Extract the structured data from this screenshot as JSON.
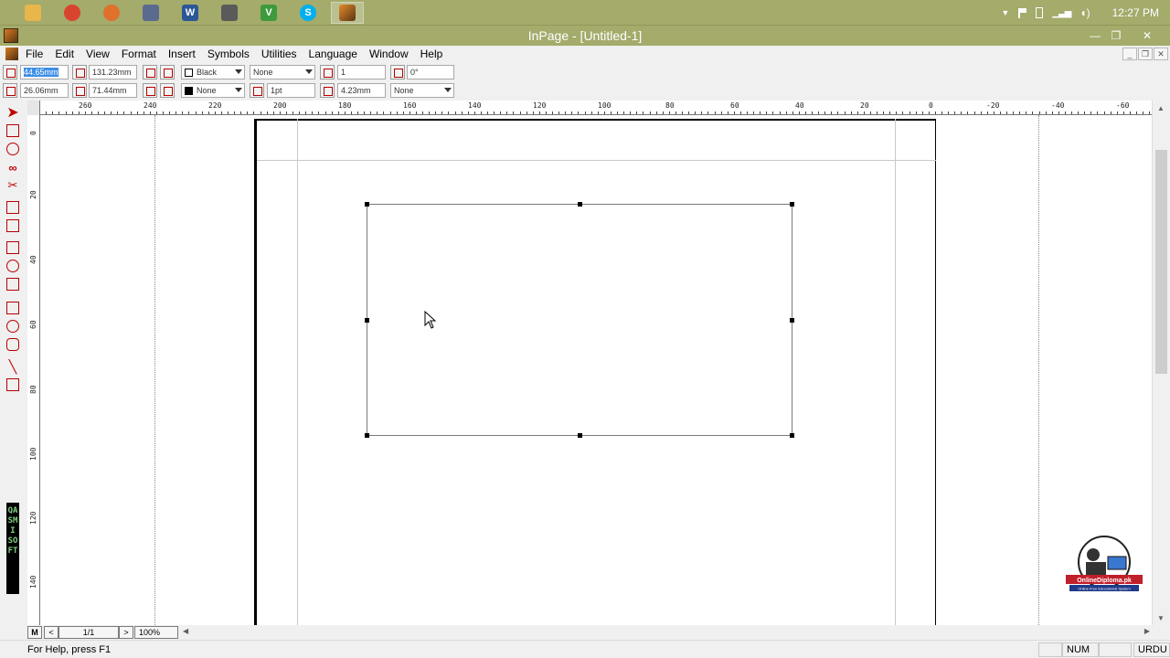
{
  "taskbar": {
    "apps": [
      {
        "icon": "file-explorer-icon",
        "color": "#e8b64a"
      },
      {
        "icon": "chrome-icon",
        "color": "#d9442e"
      },
      {
        "icon": "firefox-icon",
        "color": "#e0712c"
      },
      {
        "icon": "document-icon",
        "color": "#5b6b8f"
      },
      {
        "icon": "word-icon",
        "color": "#2b5797"
      },
      {
        "icon": "lamp-app-icon",
        "color": "#5a5a5a"
      },
      {
        "icon": "vivaldi-icon",
        "color": "#3d9a3d"
      },
      {
        "icon": "skype-icon",
        "color": "#00aff0"
      },
      {
        "icon": "inpage-icon",
        "color": "#c06a1a"
      }
    ],
    "clock": "12:27 PM"
  },
  "window": {
    "title": "InPage - [Untitled-1]"
  },
  "menu": {
    "items": [
      "File",
      "Edit",
      "View",
      "Format",
      "Insert",
      "Symbols",
      "Utilities",
      "Language",
      "Window",
      "Help"
    ]
  },
  "toolbar": {
    "x_pos": "44.65mm",
    "y_pos": "26.06mm",
    "width": "131.23mm",
    "height": "71.44mm",
    "border_color": "Black",
    "fill_color": "None",
    "border_style": "None",
    "border_width": "1pt",
    "columns": "1",
    "gutter": "4.23mm",
    "angle": "0°",
    "text_wrap": "None"
  },
  "ruler": {
    "top_labels": [
      "260",
      "240",
      "220",
      "200",
      "180",
      "160",
      "140",
      "120",
      "100",
      "80",
      "60",
      "40",
      "20",
      "0",
      "-20",
      "-40",
      "-60"
    ],
    "left_labels": [
      "0",
      "20",
      "40",
      "60",
      "80",
      "100",
      "120",
      "140"
    ]
  },
  "left_tools": {
    "brand_text": "QASMI SOFT"
  },
  "bottom_nav": {
    "master": "M",
    "prev": "<",
    "page": "1/1",
    "next": ">",
    "zoom": "100%"
  },
  "status": {
    "help": "For Help, press F1",
    "num": "NUM",
    "lang": "URDU"
  },
  "watermark": {
    "site": "OnlineDiploma.pk",
    "tagline": "Online Free Educational System"
  },
  "colors": {
    "taskbar": "#a4ab6b",
    "selection": "#3d8ee8",
    "tool_red": "#b80000"
  }
}
